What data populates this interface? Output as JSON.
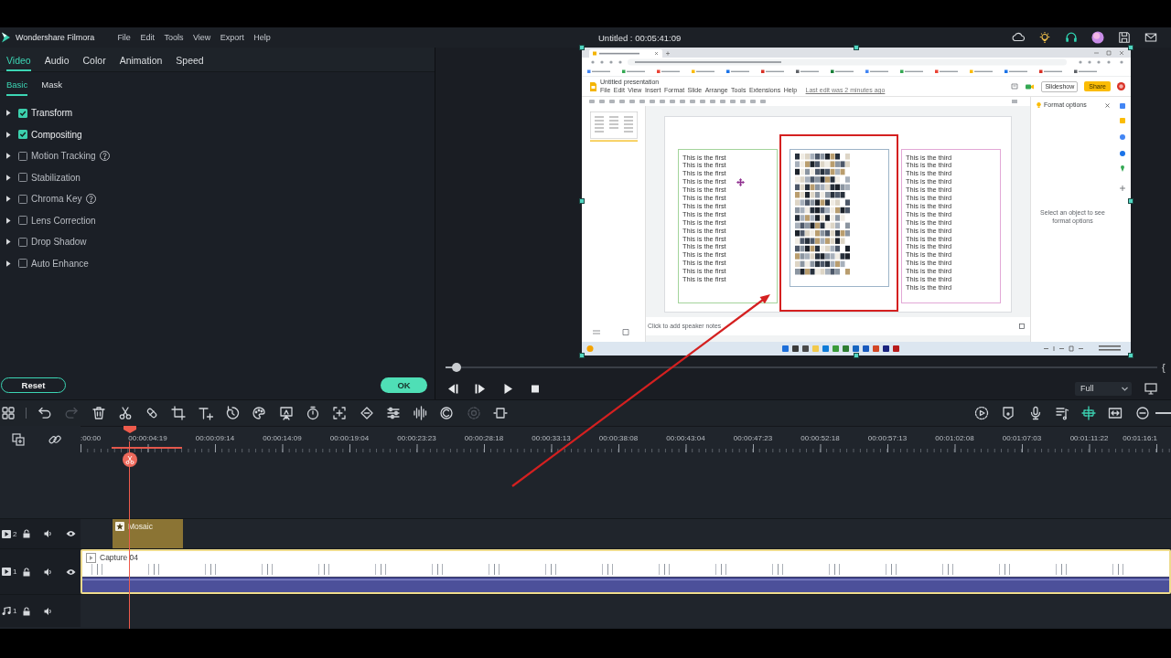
{
  "app": {
    "name": "Wondershare Filmora",
    "menu": [
      "File",
      "Edit",
      "Tools",
      "View",
      "Export",
      "Help"
    ],
    "title": "Untitled : 00:05:41:09"
  },
  "properties": {
    "tabs": [
      {
        "label": "Video",
        "selected": true
      },
      {
        "label": "Audio",
        "selected": false
      },
      {
        "label": "Color",
        "selected": false
      },
      {
        "label": "Animation",
        "selected": false
      },
      {
        "label": "Speed",
        "selected": false
      }
    ],
    "subtabs": [
      {
        "label": "Basic",
        "selected": true
      },
      {
        "label": "Mask",
        "selected": false
      }
    ],
    "sections": [
      {
        "label": "Transform",
        "checked": true,
        "expanded": false,
        "help": false
      },
      {
        "label": "Compositing",
        "checked": true,
        "expanded": false,
        "help": false
      },
      {
        "label": "Motion Tracking",
        "checked": false,
        "expanded": false,
        "help": true
      },
      {
        "label": "Stabilization",
        "checked": false,
        "expanded": false,
        "help": false
      },
      {
        "label": "Chroma Key",
        "checked": false,
        "expanded": false,
        "help": true
      },
      {
        "label": "Lens Correction",
        "checked": false,
        "expanded": false,
        "help": false
      },
      {
        "label": "Drop Shadow",
        "checked": false,
        "expanded": false,
        "help": false
      },
      {
        "label": "Auto Enhance",
        "checked": false,
        "expanded": false,
        "help": false
      }
    ],
    "buttons": [
      {
        "label": "Reset",
        "kind": "outline"
      },
      {
        "label": "OK",
        "kind": "primary"
      }
    ]
  },
  "preview": {
    "screen": {
      "title": "Untitled presentation",
      "menu": [
        "File",
        "Edit",
        "View",
        "Insert",
        "Format",
        "Slide",
        "Arrange",
        "Tools",
        "Extensions",
        "Help"
      ],
      "last_edit": "Last edit was 2 minutes ago",
      "slideshow": "Slideshow",
      "share": "Share",
      "panel_title": "Format options",
      "panel_hint": "Select an object to see format options",
      "notes": {
        "placeholder": "Click to add speaker notes"
      },
      "boxes": [
        {
          "kind": "text",
          "color": "#a3d49b",
          "highlighted": false,
          "move_cursor": true,
          "lines": [
            "This is the first",
            "This is the first",
            "This is the first",
            "This is the first",
            "This is the first",
            "This is the first",
            "This is the first",
            "This is the first",
            "This is the first",
            "This is the first",
            "This is the first",
            "This is the first",
            "This is the first",
            "This is the first",
            "This is the first",
            "This is the first"
          ]
        },
        {
          "kind": "pixelated",
          "color": "#9db4c8",
          "highlighted": true,
          "move_cursor": false
        },
        {
          "kind": "text",
          "color": "#e2a8d6",
          "highlighted": false,
          "move_cursor": false,
          "lines": [
            "This is the third",
            "This is the third",
            "This is the third",
            "This is the third",
            "This is the third",
            "This is the third",
            "This is the third",
            "This is the third",
            "This is the third",
            "This is the third",
            "This is the third",
            "This is the third",
            "This is the third",
            "This is the third",
            "This is the third",
            "This is the third",
            "This is the third"
          ]
        }
      ]
    },
    "progress": {
      "level": 0.015
    },
    "edge_glyph": "{",
    "quality": "Full"
  },
  "toolbar": {
    "left": [
      {
        "kind": "layout",
        "disabled": false
      },
      {
        "kind": "undo",
        "disabled": false
      },
      {
        "kind": "redo",
        "disabled": true
      },
      {
        "kind": "delete",
        "disabled": false
      },
      {
        "kind": "cut",
        "disabled": false
      },
      {
        "kind": "tag",
        "disabled": false
      },
      {
        "kind": "crop",
        "disabled": false
      },
      {
        "kind": "text",
        "disabled": false
      },
      {
        "kind": "duration",
        "disabled": false
      },
      {
        "kind": "color",
        "disabled": false
      },
      {
        "kind": "sticker",
        "disabled": false
      },
      {
        "kind": "speed",
        "disabled": false
      },
      {
        "kind": "zoom",
        "disabled": false
      },
      {
        "kind": "keyframe",
        "disabled": false
      },
      {
        "kind": "adjust",
        "disabled": false
      },
      {
        "kind": "audio",
        "disabled": false
      },
      {
        "kind": "motion",
        "disabled": false
      },
      {
        "kind": "portrait",
        "disabled": true
      },
      {
        "kind": "split",
        "disabled": false
      }
    ],
    "right": [
      {
        "kind": "render",
        "on": false
      },
      {
        "kind": "marker",
        "on": false
      },
      {
        "kind": "voiceover",
        "on": false
      },
      {
        "kind": "mixer",
        "on": false
      },
      {
        "kind": "snap",
        "on": true
      },
      {
        "kind": "fit",
        "on": false
      },
      {
        "kind": "zoomout",
        "on": false
      }
    ]
  },
  "timeline": {
    "ruler": [
      ":00:00",
      "00:00:04:19",
      "00:00:09:14",
      "00:00:14:09",
      "00:00:19:04",
      "00:00:23:23",
      "00:00:28:18",
      "00:00:33:13",
      "00:00:38:08",
      "00:00:43:04",
      "00:00:47:23",
      "00:00:52:18",
      "00:00:57:13",
      "00:01:02:08",
      "00:01:07:03",
      "00:01:11:22",
      "00:01:16:1"
    ],
    "playhead": {
      "level": 0.045
    },
    "tracks": [
      {
        "kind": "video",
        "number": "2",
        "clips": [
          {
            "kind": "effect",
            "label": "Mosaic"
          }
        ]
      },
      {
        "kind": "video",
        "number": "1",
        "clips": [
          {
            "kind": "video",
            "label": "Capture 04"
          }
        ]
      },
      {
        "kind": "audio",
        "number": "1"
      }
    ]
  }
}
